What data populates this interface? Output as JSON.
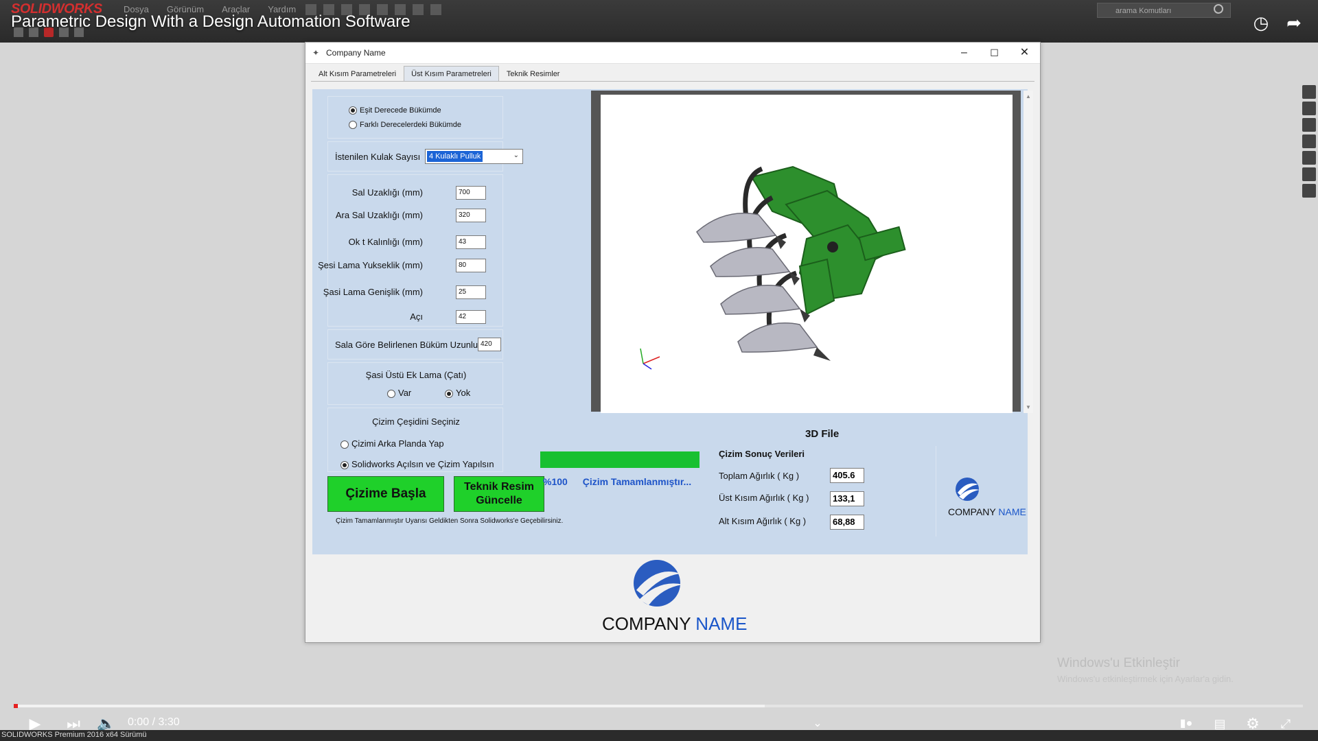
{
  "video": {
    "title": "Parametric Design With a Design Automation Software",
    "time": "0:00 / 3:30",
    "progress_fraction": 0.0
  },
  "solidworks": {
    "logo": "SOLIDWORKS",
    "menu": [
      "Dosya",
      "Görünüm",
      "Araçlar",
      "Yardım"
    ],
    "search_placeholder": "arama Komutları",
    "status": "SOLIDWORKS Premium 2016 x64 Sürümü"
  },
  "window": {
    "title": "Company Name",
    "tabs": [
      "Alt Kısım Parametreleri",
      "Üst Kısım Parametreleri",
      "Teknik Resimler"
    ],
    "active_tab": 1
  },
  "bending": {
    "option1": "Eşit Derecede Bükümde",
    "option2": "Farklı Derecelerdeki Bükümde",
    "selected": 0
  },
  "kulak": {
    "label": "İstenilen Kulak Sayısı",
    "value": "4 Kulaklı Pulluk"
  },
  "params": [
    {
      "label": "Sal Uzaklığı (mm)",
      "value": "700"
    },
    {
      "label": "Ara Sal Uzaklığı (mm)",
      "value": "320"
    },
    {
      "label": "Ok t Kalınlığı (mm)",
      "value": "43"
    },
    {
      "label": "Şesi Lama Yukseklik (mm)",
      "value": "80"
    },
    {
      "label": "Şasi Lama Genişlik (mm)",
      "value": "25"
    },
    {
      "label": "Açı",
      "value": "42"
    }
  ],
  "bukum": {
    "label": "Sala Göre Belirlenen Büküm Uzunluğu",
    "value": "420"
  },
  "ek_lama": {
    "title": "Şasi Üstü Ek Lama (Çatı)",
    "opt_var": "Var",
    "opt_yok": "Yok",
    "selected": "Yok"
  },
  "cizim": {
    "title": "Çizim Çeşidini Seçiniz",
    "opt1": "Çizimi Arka Planda Yap",
    "opt2": "Solidworks Açılsın ve Çizim Yapılsın",
    "selected": 1
  },
  "buttons": {
    "start": "Çizime Başla",
    "update_line1": "Teknik Resim",
    "update_line2": "Güncelle"
  },
  "note": "Çizim Tamamlanmıştır Uyarısı Geldikten Sonra Solidworks'e Geçebilirsiniz.",
  "progress": {
    "fraction": 1.0,
    "percent_text": "%100",
    "status_text": "Çizim Tamamlanmıştır..."
  },
  "viewer": {
    "file_label": "3D File"
  },
  "results": {
    "title": "Çizim Sonuç Verileri",
    "rows": [
      {
        "label": "Toplam Ağırlık ( Kg )",
        "value": "405.6"
      },
      {
        "label": "Üst Kısım Ağırlık ( Kg )",
        "value": "133,1"
      },
      {
        "label": "Alt Kısım Ağırlık ( Kg )",
        "value": "68,88"
      }
    ]
  },
  "brand": {
    "word1": "COMPANY",
    "word2": "NAME"
  },
  "windows_watermark": {
    "line1": "Windows'u Etkinleştir",
    "line2": "Windows'u etkinleştirmek için Ayarlar'a gidin."
  },
  "colors": {
    "panel_bg": "#c9d9ec",
    "progress_green": "#18c030",
    "button_green": "#1fd02a",
    "brand_blue": "#1a56c9",
    "yt_red": "#e52020"
  }
}
